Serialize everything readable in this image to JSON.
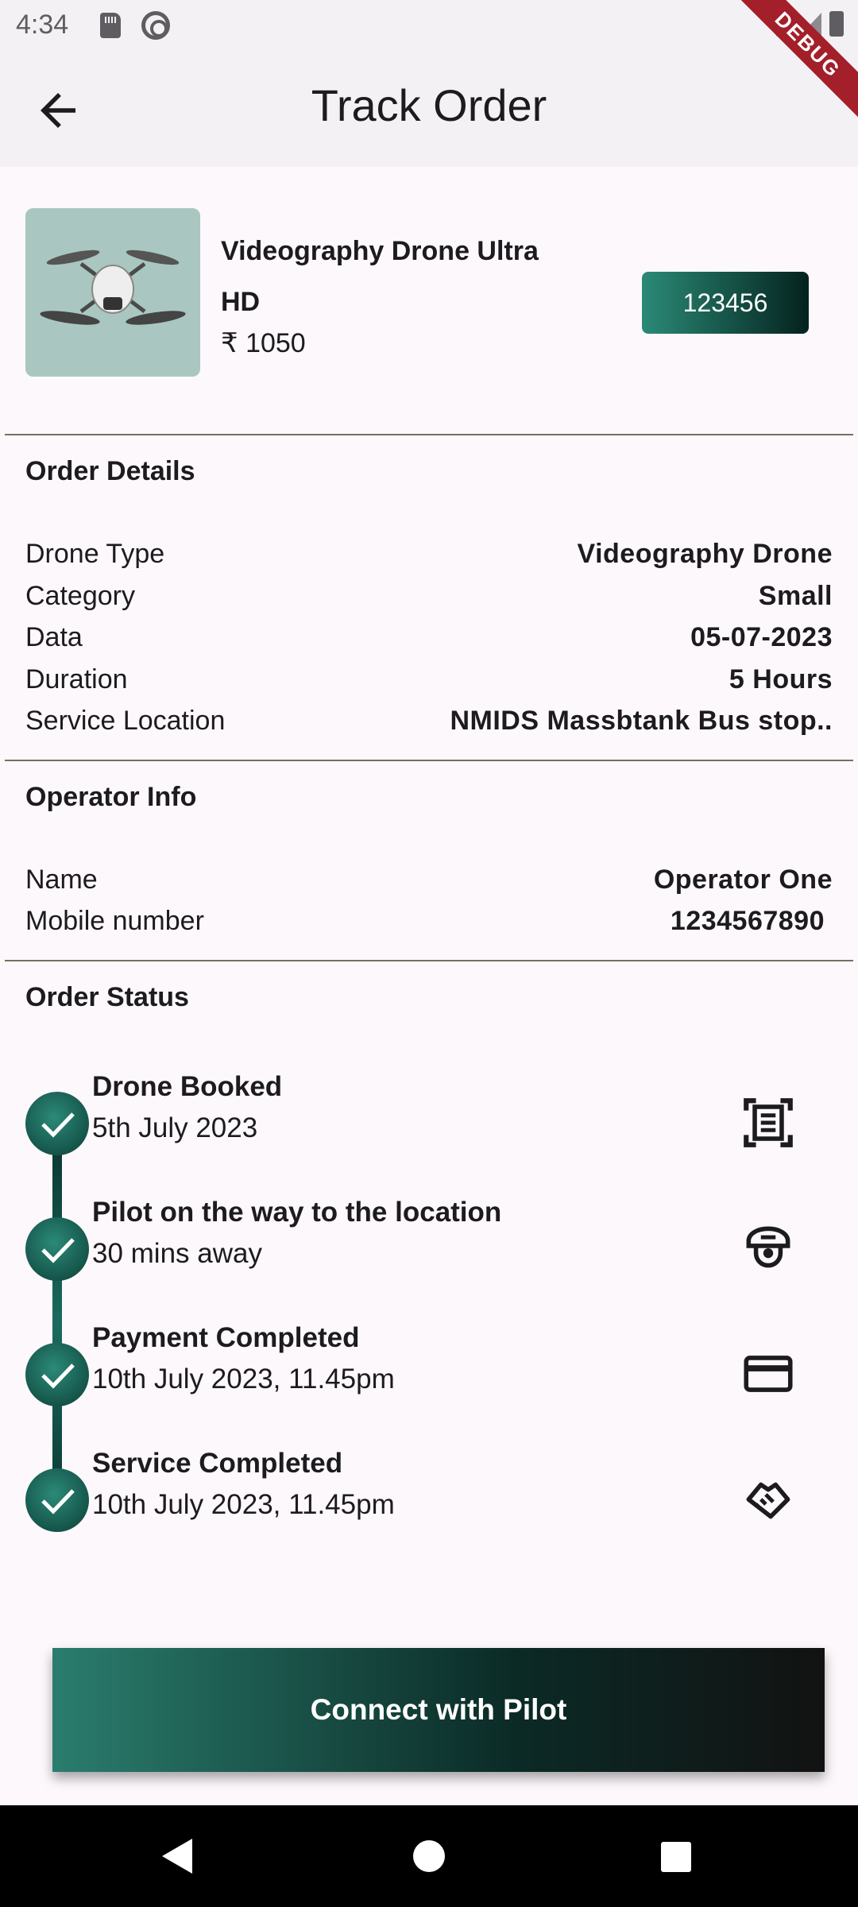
{
  "status_bar": {
    "time": "4:34",
    "debug_label": "DEBUG"
  },
  "app_bar": {
    "title": "Track Order"
  },
  "product": {
    "name": "Videography Drone Ultra HD",
    "price": "₹ 1050",
    "order_id": "123456"
  },
  "order_details": {
    "title": "Order Details",
    "rows": [
      {
        "label": "Drone Type",
        "value": "Videography Drone"
      },
      {
        "label": "Category",
        "value": "Small"
      },
      {
        "label": "Data",
        "value": "05-07-2023"
      },
      {
        "label": "Duration",
        "value": "5 Hours"
      },
      {
        "label": "Service Location",
        "value": "NMIDS Massbtank Bus stop.."
      }
    ]
  },
  "operator_info": {
    "title": "Operator Info",
    "rows": [
      {
        "label": "Name",
        "value": "Operator One"
      },
      {
        "label": "Mobile number",
        "value": "1234567890"
      }
    ]
  },
  "order_status": {
    "title": "Order Status",
    "steps": [
      {
        "title": "Drone Booked",
        "subtitle": "5th July 2023",
        "icon": "document-scan-icon"
      },
      {
        "title": "Pilot on the way to the location",
        "subtitle": "30 mins away",
        "icon": "pilot-helmet-icon"
      },
      {
        "title": "Payment Completed",
        "subtitle": "10th July 2023, 11.45pm",
        "icon": "credit-card-icon"
      },
      {
        "title": "Service Completed",
        "subtitle": "10th July 2023, 11.45pm",
        "icon": "handshake-icon"
      }
    ]
  },
  "cta": {
    "label": "Connect with Pilot"
  },
  "colors": {
    "accent_start": "#2b8a76",
    "accent_end": "#04221e",
    "background": "#fdf8fc"
  }
}
